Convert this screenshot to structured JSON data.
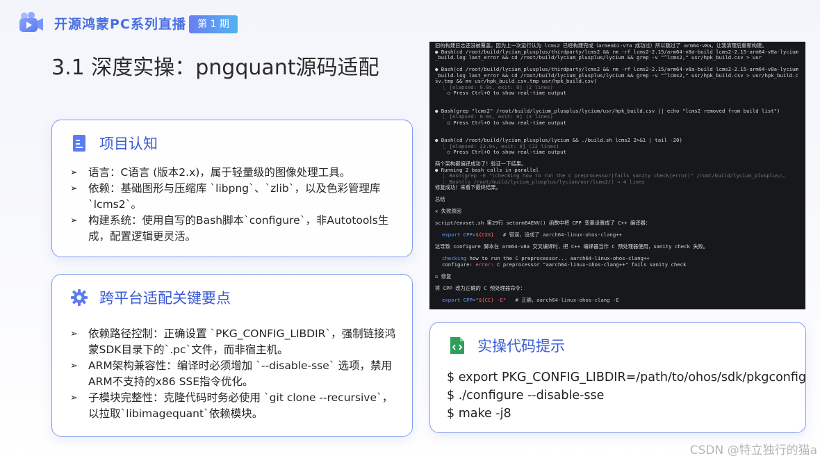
{
  "header": {
    "logo_icon": "video-play-icon",
    "series_title": "开源鸿蒙PC系列直播",
    "period_badge": "第 1 期",
    "accent_color": "#4a6fe0"
  },
  "page_title": "3.1 深度实操：pngquant源码适配",
  "cards": {
    "project": {
      "icon": "document-icon",
      "title": "项目认知",
      "items": [
        "语言：C语言 (版本2.x)，属于轻量级的图像处理工具。",
        "依赖：基础图形与压缩库 `libpng`、`zlib`，以及色彩管理库 `lcms2`。",
        "构建系统：使用自写的Bash脚本`configure`，非Autotools生成，配置逻辑更灵活。"
      ]
    },
    "keypoints": {
      "icon": "gear-icon",
      "title": "跨平台适配关键要点",
      "items": [
        "依赖路径控制：正确设置 `PKG_CONFIG_LIBDIR`，强制链接鸿蒙SDK目录下的`.pc`文件，而非宿主机。",
        "ARM架构兼容性：编译时必须增加 `--disable-sse` 选项，禁用ARM不支持的x86 SSE指令优化。",
        "子模块完整性：克隆代码时务必使用 `git clone --recursive`，以拉取`libimagequant`依赖模块。"
      ]
    },
    "code": {
      "icon": "code-icon",
      "title": "实操代码提示",
      "lines": [
        "$ export PKG_CONFIG_LIBDIR=/path/to/ohos/sdk/pkgconfig",
        "$ ./configure --disable-sse",
        "$ make -j8"
      ]
    }
  },
  "terminal": {
    "l1": "旧的构建日志还没被覆盖，因为上一次运行认为 lcms2 已经构建完成（armeabi-v7a 成功过）所以跳过了 arm64-v8a。让我清理后重新构建。",
    "l2": "● Bash(cd /root/build/lycium_plusplus/thirdparty/lcms2 && rm -rf lcms2-2.15/arm64-v8a-build lcms2-2.15-arm64-v8a-lycium_build.log last_error && cd /root/build/lycium_plusplus/lycium && grep -v \"^lcms2,\" usr/hpk_build.csv > usr",
    "l3": "● Bash(cd /root/build/lycium_plusplus/thirdparty/lcms2 && rm -rf lcms2-2.15/arm64-v8a-build lcms2-2.15-arm64-v8a-lycium_build.log last_error && cd /root/build/lycium_plusplus/lycium && grep -v \"^lcms2,\" usr/hpk_build.csv > usr/hpk_build.csv.tmp && mv usr/hpk_build.csv.tmp usr/hpk_build.csv)",
    "l3a": "  ⎿ [elapsed: 0.0s, exit: 0] (2 lines)",
    "l3b": "    ○ Press Ctrl+O to show real-time output",
    "l4": "● Bash(grep \"lcms2\" /root/build/lycium_plusplus/lycium/usr/hpk_build.csv || echo \"lcms2 removed from build list\")",
    "l4a": "  ⎿ [elapsed: 0.0s, exit: 0] (3 lines)",
    "l4b": "    ○ Press Ctrl+O to show real-time output",
    "l5": "● Bash(cd /root/build/lycium_plusplus/lycium && ./build.sh lcms2 2>&1 | tail -20)",
    "l5a": "  ⎿ [elapsed: 22.9s, exit: 0] (22 lines)",
    "l5b": "    ○ Press Ctrl+O to show real-time output",
    "l6": "两个架构都编译成功了！验证一下结果。",
    "l7": "● Running 2 bash calls in parallel",
    "l7a": "  ⎿ Bash(grep -E \"(checking how to run the C preprocessor|fails sanity check|error)\" /root/build/lycium_plusplus/…",
    "l7b": "  ⎿ Bash(ls /root/build/lycium_plusplus/lycium/usr/lcms2/) → 4 lines",
    "l8": "修复成功！来看下最终结果。",
    "l9": "总结",
    "l10": "✕ 失败原因",
    "l11": "script/envset.sh 第29行 setarm64ENV() 函数中将 CPP 变量设置成了 C++ 编译器：",
    "l12a": "export CPP=",
    "l12b": "${CXX}",
    "l12c": "   # 错误，设成了 aarch64-linux-ohos-clang++",
    "l13": "这导致 configure 脚本在 arm64-v8a 交叉编译时，把 C++ 编译器当作 C 预处理器使用，sanity check 失败。",
    "l14a": "checking",
    "l14b": " how to run the C preprocessor... aarch64-linux-ohos-clang++",
    "l15a": "configure: ",
    "l15b": "error:",
    "l15c": " C preprocessor \"aarch64-linux-ohos-clang++\" fails sanity check",
    "l16": "☑ 修复",
    "l17": "将 CPP 改为正确的 C 预处理器命令：",
    "l18a": "export CPP=",
    "l18b": "\"${CC} -E\"",
    "l18c": "   # 正确，aarch64-linux-ohos-clang -E"
  },
  "watermark": "CSDN @特立独行的猫a"
}
